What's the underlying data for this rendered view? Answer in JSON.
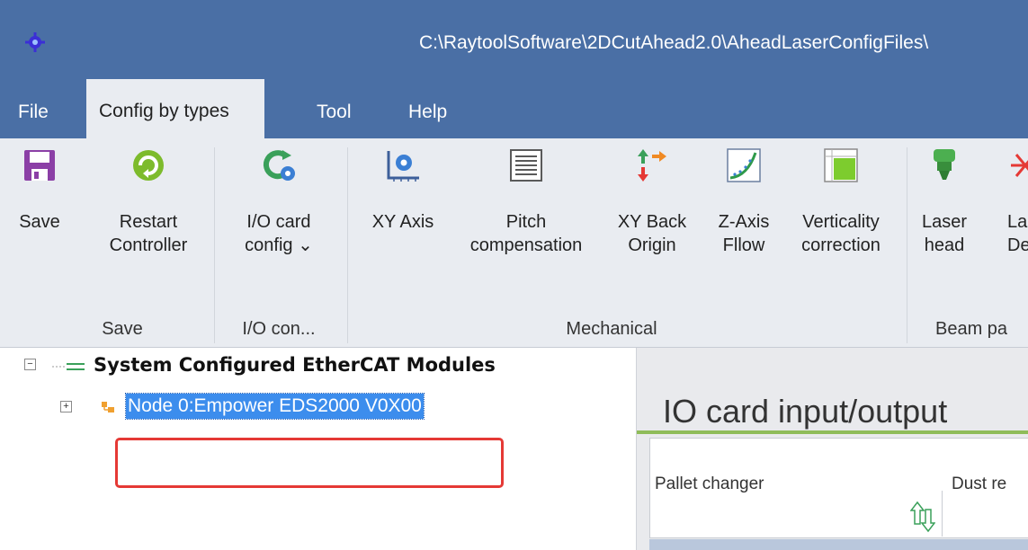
{
  "window": {
    "title": "C:\\RaytoolSoftware\\2DCutAhead2.0\\AheadLaserConfigFiles\\"
  },
  "menu": {
    "tabs": [
      "File",
      "Config by types",
      "Tool",
      "Help"
    ],
    "active_tab": "Config by types"
  },
  "ribbon": {
    "buttons": [
      {
        "label": "Save",
        "icon": "floppy-disk-icon"
      },
      {
        "label": "Restart\nController",
        "icon": "restart-arrow-icon"
      },
      {
        "label": "I/O card\nconfig ⌄",
        "icon": "io-config-gear-icon"
      },
      {
        "label": "XY Axis",
        "icon": "xy-axis-gear-icon"
      },
      {
        "label": "Pitch\ncompensation",
        "icon": "pitch-compensation-icon"
      },
      {
        "label": "XY Back\nOrigin",
        "icon": "back-origin-arrows-icon"
      },
      {
        "label": "Z-Axis\nFllow",
        "icon": "z-axis-follow-curve-icon"
      },
      {
        "label": "Verticality\ncorrection",
        "icon": "verticality-grid-icon"
      },
      {
        "label": "Laser\nhead",
        "icon": "laser-head-icon"
      },
      {
        "label": "La\nDe",
        "icon": "laser-device-icon"
      }
    ],
    "groups": [
      "Save",
      "I/O con...",
      "Mechanical",
      "Beam pa"
    ]
  },
  "tree": {
    "root_label": "System Configured EtherCAT Modules",
    "node_label": "Node 0:Empower EDS2000 V0X00"
  },
  "content": {
    "title": "IO card input/output",
    "list_headers": [
      "Pallet changer",
      "Dust re"
    ]
  },
  "colors": {
    "title_bar": "#4a6fa5",
    "ribbon_bg": "#e9ecf1",
    "selection": "#3c8ded",
    "highlight_box": "#e53935",
    "accent_green": "#8fbc5a"
  }
}
